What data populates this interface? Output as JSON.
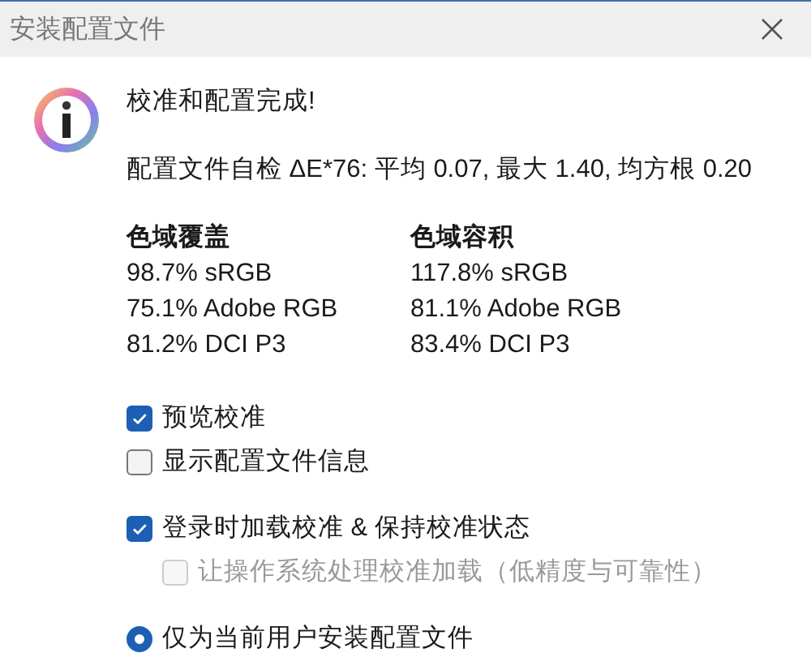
{
  "window": {
    "title": "安装配置文件"
  },
  "message": {
    "heading": "校准和配置完成!",
    "detail": "配置文件自检 ΔE*76: 平均 0.07, 最大 1.40, 均方根 0.20"
  },
  "gamut": [
    {
      "heading": "色域覆盖",
      "rows": [
        "98.7% sRGB",
        "75.1% Adobe RGB",
        "81.2% DCI P3"
      ]
    },
    {
      "heading": "色域容积",
      "rows": [
        "117.8% sRGB",
        "81.1% Adobe RGB",
        "83.4% DCI P3"
      ]
    }
  ],
  "option_groups": [
    [
      {
        "kind": "checkbox",
        "label": "预览校准",
        "checked": true
      },
      {
        "kind": "checkbox",
        "label": "显示配置文件信息",
        "checked": false
      }
    ],
    [
      {
        "kind": "checkbox",
        "label": "登录时加载校准 & 保持校准状态",
        "checked": true,
        "children": [
          {
            "kind": "checkbox",
            "label": "让操作系统处理校准加载（低精度与可靠性）",
            "checked": false,
            "disabled": true
          }
        ]
      }
    ],
    [
      {
        "kind": "radio",
        "label": "仅为当前用户安装配置文件",
        "selected": true
      }
    ]
  ]
}
